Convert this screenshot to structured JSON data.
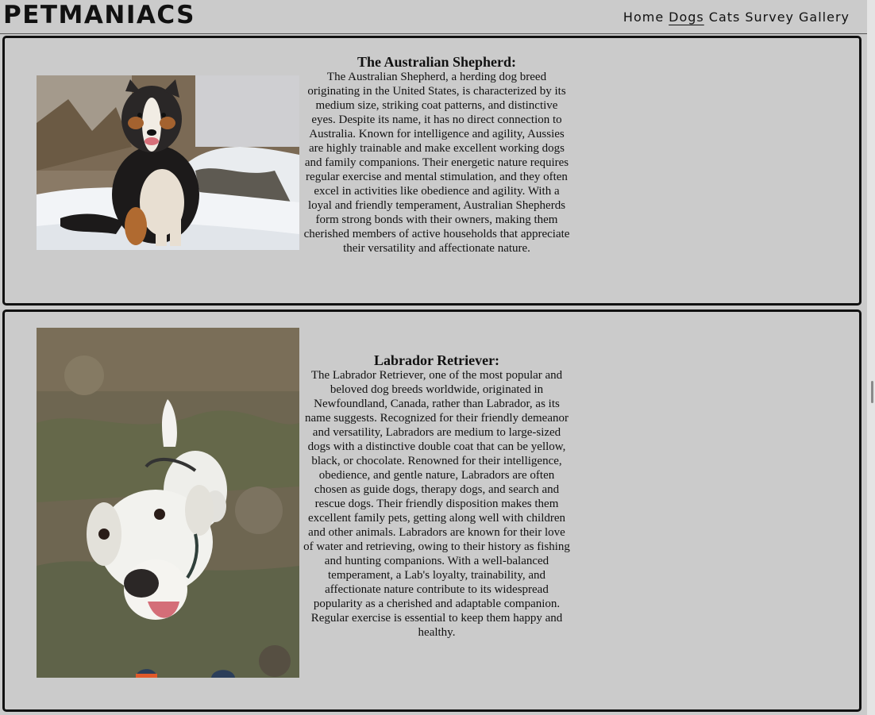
{
  "site": {
    "logo": "PETMANIACS"
  },
  "nav": {
    "items": [
      {
        "label": "Home"
      },
      {
        "label": "Dogs"
      },
      {
        "label": "Cats"
      },
      {
        "label": "Survey"
      },
      {
        "label": "Gallery"
      }
    ],
    "active": "Dogs"
  },
  "breeds": [
    {
      "title": "The Australian Shepherd:",
      "description": "The Australian Shepherd, a herding dog breed originating in the United States, is characterized by its medium size, striking coat patterns, and distinctive eyes. Despite its name, it has no direct connection to Australia. Known for intelligence and agility, Aussies are highly trainable and make excellent working dogs and family companions. Their energetic nature requires regular exercise and mental stimulation, and they often excel in activities like obedience and agility. With a loyal and friendly temperament, Australian Shepherds form strong bonds with their owners, making them cherished members of active households that appreciate their versatility and affectionate nature.",
      "photo_icon": "australian-shepherd-photo"
    },
    {
      "title": "Labrador Retriever:",
      "description": "The Labrador Retriever, one of the most popular and beloved dog breeds worldwide, originated in Newfoundland, Canada, rather than Labrador, as its name suggests. Recognized for their friendly demeanor and versatility, Labradors are medium to large-sized dogs with a distinctive double coat that can be yellow, black, or chocolate. Renowned for their intelligence, obedience, and gentle nature, Labradors are often chosen as guide dogs, therapy dogs, and search and rescue dogs. Their friendly disposition makes them excellent family pets, getting along well with children and other animals. Labradors are known for their love of water and retrieving, owing to their history as fishing and hunting companions. With a well-balanced temperament, a Lab's loyalty, trainability, and affectionate nature contribute to its widespread popularity as a cherished and adaptable companion. Regular exercise is essential to keep them happy and healthy.",
      "photo_icon": "labrador-photo"
    }
  ],
  "colors": {
    "page_bg": "#cbcbcb",
    "border": "#111111"
  }
}
